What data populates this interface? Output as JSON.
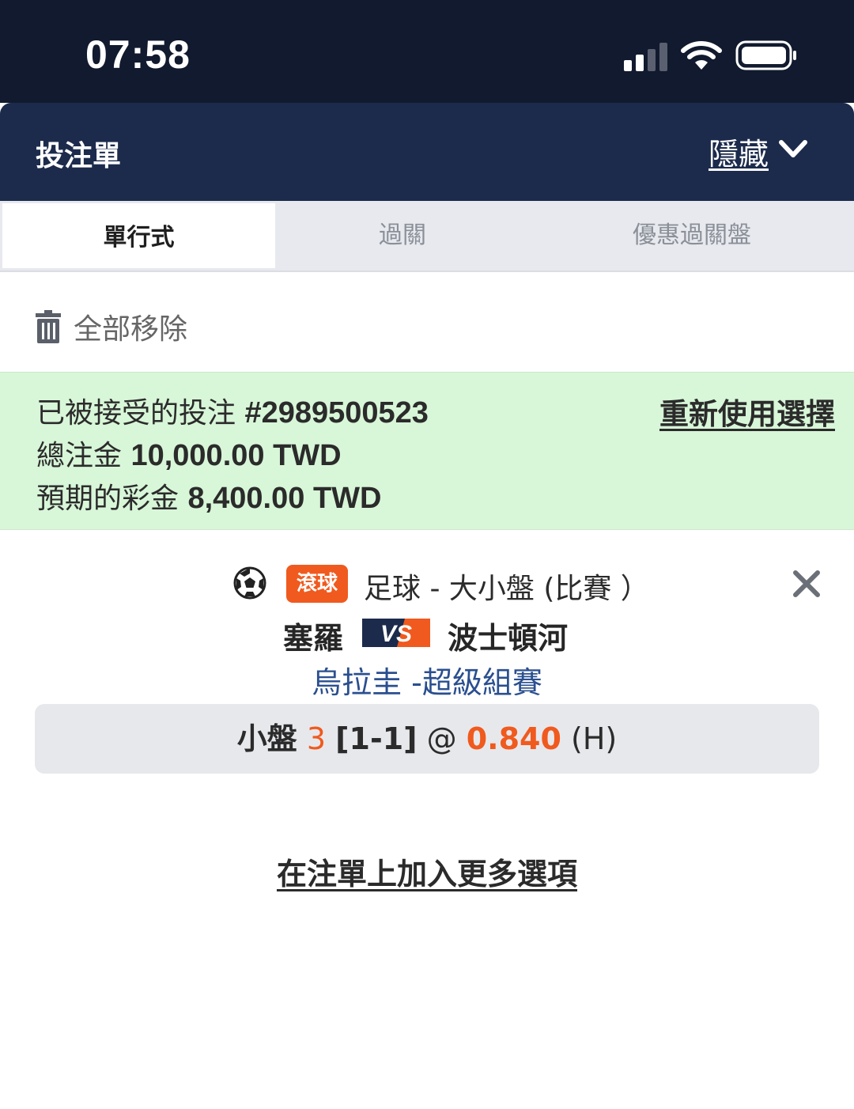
{
  "status_bar": {
    "time": "07:58",
    "signal_icon": "cellular-signal-icon",
    "wifi_icon": "wifi-icon",
    "battery_icon": "battery-icon"
  },
  "header": {
    "title": "投注單",
    "hide_label": "隱藏",
    "chevron_icon": "chevron-down-icon"
  },
  "tabs": [
    {
      "label": "單行式",
      "active": true
    },
    {
      "label": "過關",
      "active": false
    },
    {
      "label": "優惠過關盤",
      "active": false
    }
  ],
  "remove_all": {
    "icon": "trash-icon",
    "label": "全部移除"
  },
  "confirmation": {
    "accepted_label": "已被接受的投注",
    "bet_id": "#2989500523",
    "stake_label": "總注金",
    "stake_value": "10,000.00 TWD",
    "payout_label": "預期的彩金",
    "payout_value": "8,400.00 TWD",
    "reuse_label": "重新使用選擇",
    "background_color": "#d8f6d8"
  },
  "bet": {
    "sport_icon": "soccer-ball-icon",
    "live_badge": "滾球",
    "market": "足球 - 大小盤 (比賽 ）",
    "home_team": "塞羅",
    "vs_label": "VS",
    "away_team": "波士頓河",
    "league": "烏拉圭 -超級組賽",
    "selection_side": "小盤",
    "selection_line": "3",
    "selection_score": "[1-1]",
    "selection_at": "@",
    "selection_odds": "0.840",
    "selection_odds_type": "(H)",
    "accent_color": "#f05a1e"
  },
  "footer": {
    "add_more_label": "在注單上加入更多選項"
  }
}
